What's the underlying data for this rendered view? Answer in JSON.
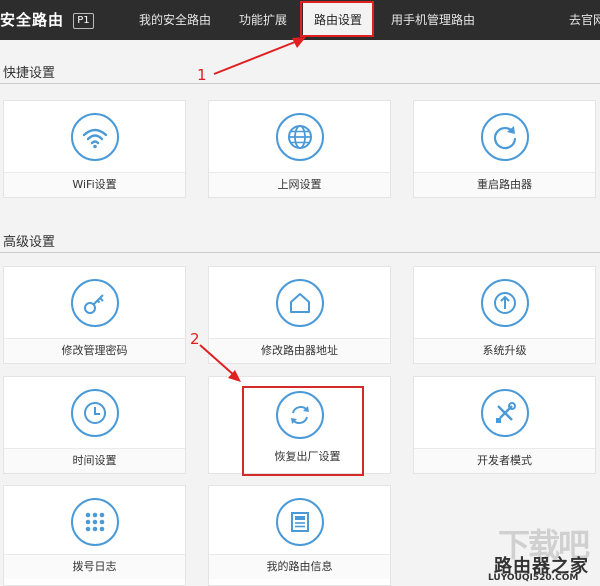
{
  "header": {
    "brand": "安全路由",
    "badge": "P1",
    "nav": {
      "my_router": "我的安全路由",
      "extensions": "功能扩展",
      "router_settings": "路由设置",
      "mobile_manage": "用手机管理路由",
      "official_site": "去官网"
    }
  },
  "sections": {
    "quick": "快捷设置",
    "advanced": "高级设置"
  },
  "quick_tiles": {
    "wifi": "WiFi设置",
    "internet": "上网设置",
    "reboot": "重启路由器"
  },
  "advanced_tiles": {
    "password": "修改管理密码",
    "address": "修改路由器地址",
    "upgrade": "系统升级",
    "time": "时间设置",
    "factory_reset": "恢复出厂设置",
    "developer": "开发者模式",
    "dial_log": "拨号日志",
    "router_info": "我的路由信息"
  },
  "annotations": {
    "step1": "1",
    "step2": "2"
  },
  "watermark": {
    "logo": "下载吧",
    "name": "路由器之家",
    "url": "LUYOUQI520.COM"
  },
  "colors": {
    "accent": "#4a9ad8",
    "highlight": "#e02020",
    "topbar": "#2d2d2d"
  }
}
